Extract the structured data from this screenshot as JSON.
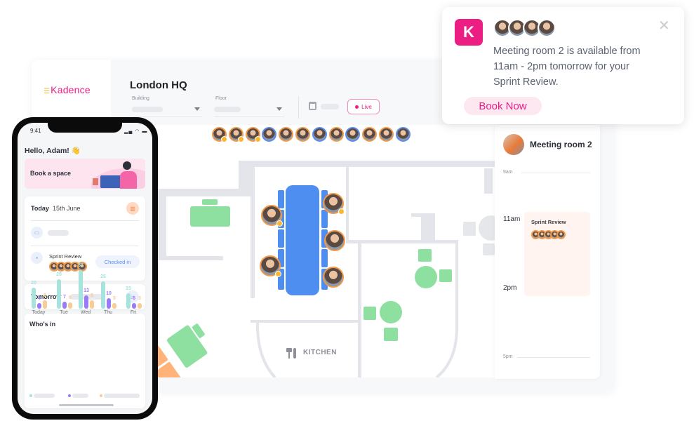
{
  "app": {
    "logo": "Kadence",
    "location_title": "London HQ"
  },
  "filters": {
    "building_label": "Building",
    "floor_label": "Floor",
    "live_label": "Live"
  },
  "floorplan": {
    "kitchen_label": "KITCHEN"
  },
  "room_panel": {
    "room_name": "Meeting room 2",
    "times": {
      "t9": "9am",
      "t11": "11am",
      "t2": "2pm",
      "t5": "5pm"
    },
    "event": {
      "title": "Sprint Review",
      "start": "11am",
      "end": "2pm",
      "color": "#fff4ef"
    }
  },
  "notification": {
    "icon": "kadence-k-logo",
    "message": "Meeting room 2 is available from 11am - 2pm tomorrow for your Sprint Review.",
    "book_label": "Book Now",
    "close_icon": "close-x-icon"
  },
  "phone": {
    "clock": "9:41",
    "greeting": "Hello, Adam! 👋",
    "book_space": "Book a space",
    "today_label": "Today",
    "today_date": "15th June",
    "meeting_title": "Sprint Review",
    "checked_in": "Checked in",
    "tomorrow_label": "Tomorrow",
    "whos_in_title": "Who's in"
  },
  "colors": {
    "brand": "#ec1e84",
    "desk_available": "#8ee0a1",
    "room_booked": "#4d8ef0",
    "desk_other": "#ffb27a"
  },
  "chart_data": {
    "type": "bar",
    "title": "Who's in",
    "categories": [
      "Today",
      "Tue",
      "Wed",
      "Thu",
      "Fri"
    ],
    "series": [
      {
        "values": [
          20,
          28,
          37,
          26,
          15
        ],
        "color": "#a6e3dd"
      },
      {
        "values": [
          4,
          7,
          13,
          10,
          5
        ],
        "color": "#9b7bf5"
      },
      {
        "values": [
          8,
          6,
          8,
          5,
          3
        ],
        "color": "#f8cc92"
      }
    ]
  }
}
